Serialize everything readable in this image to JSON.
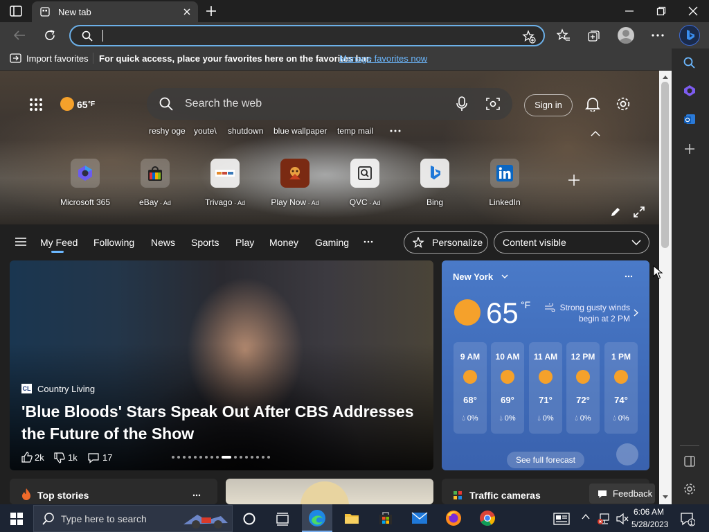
{
  "browser": {
    "tab_title": "New tab",
    "address_value": "",
    "favbar": {
      "import_label": "Import favorites",
      "message": "For quick access, place your favorites here on the favorites bar.",
      "manage_link": "Manage favorites now"
    }
  },
  "hero": {
    "temperature": "65",
    "temp_unit": "°F",
    "search_placeholder": "Search the web",
    "sign_in": "Sign in",
    "recent_searches": [
      "reshy oge",
      "youte\\",
      "shutdown",
      "blue wallpaper",
      "temp mail"
    ],
    "quick_links": [
      {
        "label": "Microsoft 365",
        "ad": ""
      },
      {
        "label": "eBay",
        "ad": "Ad"
      },
      {
        "label": "Trivago",
        "ad": "Ad"
      },
      {
        "label": "Play Now",
        "ad": "Ad"
      },
      {
        "label": "QVC",
        "ad": "Ad"
      },
      {
        "label": "Bing",
        "ad": ""
      },
      {
        "label": "LinkedIn",
        "ad": ""
      }
    ]
  },
  "feed_nav": {
    "items": [
      "My Feed",
      "Following",
      "News",
      "Sports",
      "Play",
      "Money",
      "Gaming"
    ],
    "active": "My Feed",
    "personalize": "Personalize",
    "content_visible": "Content visible"
  },
  "story": {
    "source_icon": "CL",
    "source": "Country Living",
    "headline": "'Blue Bloods' Stars Speak Out After CBS Addresses the Future of the Show",
    "likes": "2k",
    "dislikes": "1k",
    "comments": "17"
  },
  "weather": {
    "city": "New York",
    "temp": "65",
    "unit": "°F",
    "alert": "Strong gusty winds begin at 2 PM",
    "hours": [
      {
        "time": "9 AM",
        "temp": "68°",
        "precip": "0%"
      },
      {
        "time": "10 AM",
        "temp": "69°",
        "precip": "0%"
      },
      {
        "time": "11 AM",
        "temp": "71°",
        "precip": "0%"
      },
      {
        "time": "12 PM",
        "temp": "72°",
        "precip": "0%"
      },
      {
        "time": "1 PM",
        "temp": "74°",
        "precip": "0%"
      }
    ],
    "forecast_button": "See full forecast"
  },
  "cards": {
    "top_stories": "Top stories",
    "traffic": "Traffic cameras",
    "feedback": "Feedback"
  },
  "taskbar": {
    "search_placeholder": "Type here to search",
    "time": "6:06 AM",
    "date": "5/28/2023",
    "notification_count": "1"
  }
}
